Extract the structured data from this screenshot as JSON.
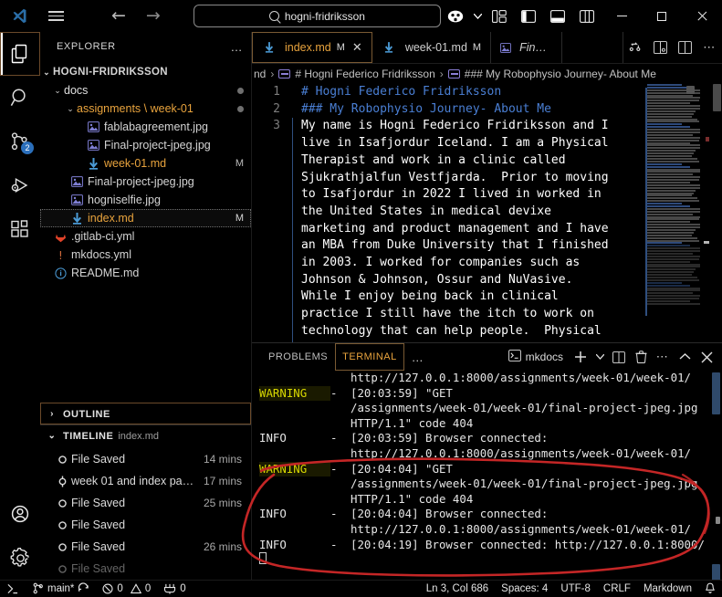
{
  "titlebar": {
    "search_value": "hogni-fridriksson",
    "back_label": "←",
    "forward_label": "→",
    "minimize_label": "minimize",
    "maximize_label": "maximize",
    "close_label": "close"
  },
  "activitybar": {
    "items": [
      {
        "name": "explorer",
        "icon": "files-icon",
        "active": true,
        "badge": ""
      },
      {
        "name": "search",
        "icon": "search-icon",
        "active": false,
        "badge": ""
      },
      {
        "name": "source-control",
        "icon": "source-control-icon",
        "active": false,
        "badge": "2"
      },
      {
        "name": "run-and-debug",
        "icon": "run-debug-icon",
        "active": false,
        "badge": ""
      },
      {
        "name": "extensions",
        "icon": "extensions-icon",
        "active": false,
        "badge": ""
      }
    ],
    "bottom": [
      {
        "name": "accounts",
        "icon": "account-icon"
      },
      {
        "name": "settings",
        "icon": "gear-icon"
      }
    ]
  },
  "sidebar": {
    "title": "EXPLORER",
    "more_label": "…",
    "root": "HOGNI-FRIDRIKSSON",
    "tree": [
      {
        "label": "docs",
        "kind": "folder",
        "indent": 1,
        "chev": "⌄",
        "mark": "",
        "dot": true,
        "selected": false
      },
      {
        "label": "assignments \\ week-01",
        "kind": "folder",
        "indent": 2,
        "chev": "⌄",
        "mark": "",
        "dot": true,
        "selected": false
      },
      {
        "label": "fablabagreement.jpg",
        "kind": "image",
        "indent": 3,
        "chev": "",
        "mark": "",
        "dot": false,
        "selected": false
      },
      {
        "label": "Final-project-jpeg.jpg",
        "kind": "image",
        "indent": 3,
        "chev": "",
        "mark": "",
        "dot": false,
        "selected": false
      },
      {
        "label": "week-01.md",
        "kind": "markdown",
        "indent": 3,
        "chev": "",
        "mark": "M",
        "dot": false,
        "selected": false
      },
      {
        "label": "Final-project-jpeg.jpg",
        "kind": "image",
        "indent": 2,
        "chev": "",
        "mark": "",
        "dot": false,
        "selected": false
      },
      {
        "label": "hogniselfie.jpg",
        "kind": "image",
        "indent": 2,
        "chev": "",
        "mark": "",
        "dot": false,
        "selected": false
      },
      {
        "label": "index.md",
        "kind": "markdown",
        "indent": 2,
        "chev": "",
        "mark": "M",
        "dot": false,
        "selected": true
      },
      {
        "label": ".gitlab-ci.yml",
        "kind": "gitlab",
        "indent": 1,
        "chev": "",
        "mark": "",
        "dot": false,
        "selected": false
      },
      {
        "label": "mkdocs.yml",
        "kind": "yaml",
        "indent": 1,
        "chev": "",
        "mark": "",
        "dot": false,
        "selected": false
      },
      {
        "label": "README.md",
        "kind": "readme",
        "indent": 1,
        "chev": "",
        "mark": "",
        "dot": false,
        "selected": false
      }
    ],
    "outline": {
      "label": "OUTLINE",
      "chev": "›"
    },
    "timeline": {
      "label": "TIMELINE",
      "file": "index.md",
      "chev": "⌄",
      "items": [
        {
          "label": "File Saved",
          "time": "14 mins",
          "icon": "save-dot-icon"
        },
        {
          "label": "week 01 and index pa…",
          "time": "17 mins",
          "icon": "commit-icon"
        },
        {
          "label": "File Saved",
          "time": "25 mins",
          "icon": "save-dot-icon"
        },
        {
          "label": "File Saved",
          "time": "",
          "icon": "save-dot-icon"
        },
        {
          "label": "File Saved",
          "time": "26 mins",
          "icon": "save-dot-icon"
        },
        {
          "label": "File Saved",
          "time": "",
          "icon": "save-dot-icon"
        }
      ]
    }
  },
  "editor": {
    "tabs": [
      {
        "label": "index.md",
        "dirty": "M",
        "active": true,
        "closable": true,
        "icon": "markdown-icon",
        "italic": false
      },
      {
        "label": "week-01.md",
        "dirty": "M",
        "active": false,
        "closable": false,
        "icon": "markdown-icon",
        "italic": false
      },
      {
        "label": "Final-project",
        "dirty": "",
        "active": false,
        "closable": false,
        "icon": "image-icon",
        "italic": true
      }
    ],
    "tab_actions": [
      "split-editor-icon",
      "split-layout-icon",
      "panel-layout-icon",
      "more-actions-icon"
    ],
    "breadcrumb": [
      {
        "text": "nd",
        "icon": ""
      },
      {
        "text": "# Hogni Federico Fridriksson",
        "icon": "symbol-string-icon"
      },
      {
        "text": "### My Robophysio Journey- About Me",
        "icon": "symbol-string-icon"
      }
    ],
    "lines": [
      {
        "num": "1",
        "text": "# Hogni Federico Fridriksson",
        "style": "heading"
      },
      {
        "num": "2",
        "text": "### My Robophysio Journey- About Me",
        "style": "heading"
      },
      {
        "num": "3",
        "text": "My name is Hogni Federico Fridriksson and I",
        "style": "body"
      },
      {
        "num": "",
        "text": "live in Isafjordur Iceland. I am a Physical",
        "style": "body"
      },
      {
        "num": "",
        "text": "Therapist and work in a clinic called",
        "style": "body"
      },
      {
        "num": "",
        "text": "Sjukrathjalfun Vestfjarda.  Prior to moving",
        "style": "body"
      },
      {
        "num": "",
        "text": "to Isafjordur in 2022 I lived in worked in",
        "style": "body"
      },
      {
        "num": "",
        "text": "the United States in medical devixe",
        "style": "body"
      },
      {
        "num": "",
        "text": "marketing and product management and I have",
        "style": "body"
      },
      {
        "num": "",
        "text": "an MBA from Duke University that I finished",
        "style": "body"
      },
      {
        "num": "",
        "text": "in 2003. I worked for companies such as",
        "style": "body"
      },
      {
        "num": "",
        "text": "Johnson & Johnson, Ossur and NuVasive.",
        "style": "body"
      },
      {
        "num": "",
        "text": "While I enjoy being back in clinical",
        "style": "body"
      },
      {
        "num": "",
        "text": "practice I still have the itch to work on",
        "style": "body"
      },
      {
        "num": "",
        "text": "technology that can help people.  Physical",
        "style": "body"
      }
    ]
  },
  "panel": {
    "tabs": [
      {
        "label": "PROBLEMS",
        "active": false
      },
      {
        "label": "TERMINAL",
        "active": true
      }
    ],
    "more_label": "…",
    "terminal_name": "mkdocs",
    "actions": [
      "new-terminal-icon",
      "chevron-down-icon",
      "split-terminal-icon",
      "kill-terminal-icon",
      "more-actions-icon",
      "maximize-panel-icon",
      "close-panel-icon"
    ],
    "terminal_lines": [
      {
        "level": "",
        "dash": "",
        "msg": "http://127.0.0.1:8000/assignments/week-01/week-01/"
      },
      {
        "level": "WARNING",
        "dash": "-",
        "msg": "[20:03:59] \"GET"
      },
      {
        "level": "",
        "dash": "",
        "msg": "/assignments/week-01/week-01/final-project-jpeg.jpg"
      },
      {
        "level": "",
        "dash": "",
        "msg": "HTTP/1.1\" code 404"
      },
      {
        "level": "INFO",
        "dash": "-",
        "msg": "[20:03:59] Browser connected:"
      },
      {
        "level": "",
        "dash": "",
        "msg": "http://127.0.0.1:8000/assignments/week-01/week-01/"
      },
      {
        "level": "WARNING",
        "dash": "-",
        "msg": "[20:04:04] \"GET"
      },
      {
        "level": "",
        "dash": "",
        "msg": "/assignments/week-01/week-01/final-project-jpeg.jpg"
      },
      {
        "level": "",
        "dash": "",
        "msg": "HTTP/1.1\" code 404"
      },
      {
        "level": "INFO",
        "dash": "-",
        "msg": "[20:04:04] Browser connected:"
      },
      {
        "level": "",
        "dash": "",
        "msg": "http://127.0.0.1:8000/assignments/week-01/week-01/"
      },
      {
        "level": "INFO",
        "dash": "-",
        "msg": "[20:04:19] Browser connected: http://127.0.0.1:8000/"
      }
    ]
  },
  "statusbar": {
    "remote_label": "",
    "branch": "main*",
    "errors": "0",
    "warnings": "0",
    "ports": "0",
    "position": "Ln 3, Col 686",
    "spaces": "Spaces: 4",
    "encoding": "UTF-8",
    "eol": "CRLF",
    "language": "Markdown",
    "bell": "bell-icon"
  },
  "annotation": {
    "color": "#c42626",
    "shape": "hand-drawn-ellipse"
  }
}
